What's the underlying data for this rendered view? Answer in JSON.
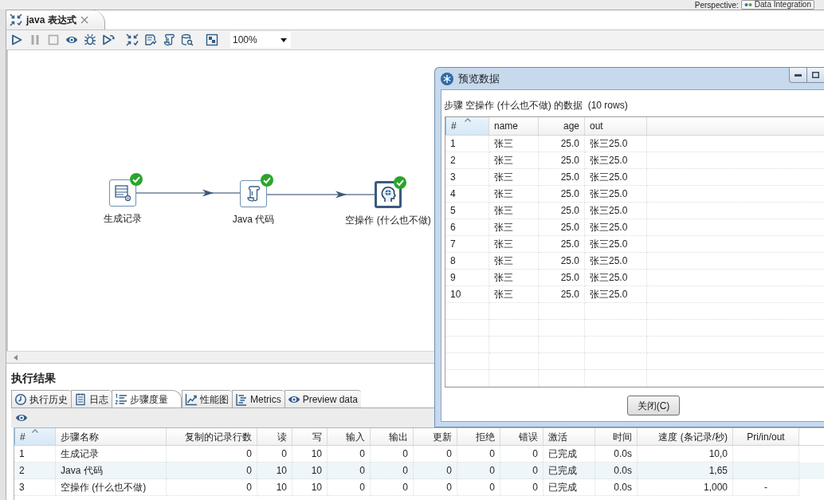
{
  "perspective": {
    "label": "Perspective:",
    "value": "Data Integration"
  },
  "editor_tab": {
    "title": "java 表达式"
  },
  "toolbar": {
    "buttons": [
      {
        "disabled": false
      },
      {
        "disabled": true
      },
      {
        "disabled": true
      },
      {
        "disabled": false
      },
      {
        "disabled": false
      },
      {
        "disabled": false
      },
      {
        "disabled": false
      },
      {
        "disabled": false
      },
      {
        "disabled": false
      },
      {
        "disabled": false
      },
      {
        "disabled": false
      }
    ],
    "zoom": "100%"
  },
  "canvas": {
    "steps": [
      {
        "label": "生成记录",
        "finished": true,
        "selected": false
      },
      {
        "label": "Java 代码",
        "finished": true,
        "selected": false
      },
      {
        "label": "空操作 (什么也不做)",
        "finished": true,
        "selected": true
      }
    ]
  },
  "results": {
    "title": "执行结果",
    "tabs": [
      {
        "label": "执行历史",
        "selected": false
      },
      {
        "label": "日志",
        "selected": false
      },
      {
        "label": "步骤度量",
        "selected": true
      },
      {
        "label": "性能图",
        "selected": false
      },
      {
        "label": "Metrics",
        "selected": false
      },
      {
        "label": "Preview data",
        "selected": false
      }
    ],
    "table": {
      "columns": [
        {
          "label": "#",
          "sorted": true
        },
        {
          "label": "步骤名称",
          "sorted": false
        },
        {
          "label": "复制的记录行数",
          "sorted": false
        },
        {
          "label": "读",
          "sorted": false
        },
        {
          "label": "写",
          "sorted": false
        },
        {
          "label": "输入",
          "sorted": false
        },
        {
          "label": "输出",
          "sorted": false
        },
        {
          "label": "更新",
          "sorted": false
        },
        {
          "label": "拒绝",
          "sorted": false
        },
        {
          "label": "错误",
          "sorted": false
        },
        {
          "label": "激活",
          "sorted": false
        },
        {
          "label": "时间",
          "sorted": false
        },
        {
          "label": "速度 (条记录/秒)",
          "sorted": false
        },
        {
          "label": "Pri/in/out",
          "sorted": false
        }
      ],
      "rows": [
        [
          "1",
          "生成记录",
          "0",
          "0",
          "10",
          "0",
          "0",
          "0",
          "0",
          "0",
          "已完成",
          "0.0s",
          "10,0"
        ],
        [
          "2",
          "Java 代码",
          "0",
          "10",
          "10",
          "0",
          "0",
          "0",
          "0",
          "0",
          "已完成",
          "0.0s",
          "1,65"
        ],
        [
          "3",
          "空操作 (什么也不做)",
          "0",
          "10",
          "10",
          "0",
          "0",
          "0",
          "0",
          "0",
          "已完成",
          "0.0s",
          "1,000",
          "-"
        ]
      ]
    }
  },
  "dialog": {
    "title": "预览数据",
    "caption": "步骤 空操作 (什么也不做) 的数据  (10 rows)",
    "table": {
      "columns": [
        {
          "label": "#",
          "sorted": true
        },
        {
          "label": "name",
          "sorted": false
        },
        {
          "label": "age",
          "sorted": false
        },
        {
          "label": "out",
          "sorted": false
        }
      ],
      "rows": [
        [
          "1",
          "张三",
          "25.0",
          "张三25.0"
        ],
        [
          "2",
          "张三",
          "25.0",
          "张三25.0"
        ],
        [
          "3",
          "张三",
          "25.0",
          "张三25.0"
        ],
        [
          "4",
          "张三",
          "25.0",
          "张三25.0"
        ],
        [
          "5",
          "张三",
          "25.0",
          "张三25.0"
        ],
        [
          "6",
          "张三",
          "25.0",
          "张三25.0"
        ],
        [
          "7",
          "张三",
          "25.0",
          "张三25.0"
        ],
        [
          "8",
          "张三",
          "25.0",
          "张三25.0"
        ],
        [
          "9",
          "张三",
          "25.0",
          "张三25.0"
        ],
        [
          "10",
          "张三",
          "25.0",
          "张三25.0"
        ]
      ]
    },
    "close_button": "关闭(C)"
  }
}
